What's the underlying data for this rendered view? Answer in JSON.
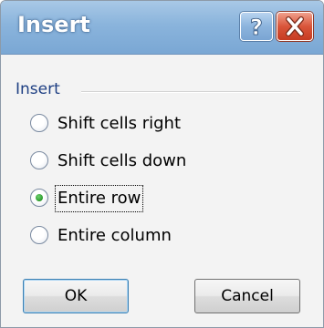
{
  "dialog": {
    "title": "Insert",
    "help_icon": "question-mark",
    "close_icon": "x-mark",
    "colors": {
      "title_bar": "#8ab4dc",
      "close_button": "#d9553a",
      "group_label": "#1e3f83",
      "radio_selected_dot": "#2a9a2a"
    }
  },
  "group": {
    "label": "Insert",
    "options": [
      {
        "label": "Shift cells right",
        "selected": false
      },
      {
        "label": "Shift cells down",
        "selected": false
      },
      {
        "label": "Entire row",
        "selected": true
      },
      {
        "label": "Entire column",
        "selected": false
      }
    ]
  },
  "buttons": {
    "ok_label": "OK",
    "cancel_label": "Cancel"
  }
}
